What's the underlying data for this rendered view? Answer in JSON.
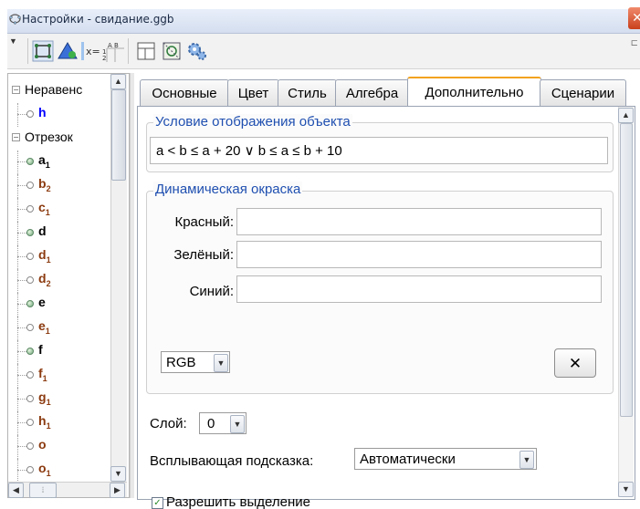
{
  "window": {
    "title": "Настройки - свидание.ggb",
    "close_symbol": "✕"
  },
  "toolbar": {
    "icons": [
      "basic-icon",
      "style-triangle-icon",
      "algebra-icon",
      "spreadsheet-icon",
      "layout-icon",
      "graphics-icon",
      "advanced-gear-icon"
    ]
  },
  "tree": {
    "items": [
      {
        "type": "group",
        "label": "Неравенс"
      },
      {
        "type": "item",
        "label": "h",
        "sub": "",
        "color": "#0000ff",
        "filled": false
      },
      {
        "type": "group",
        "label": "Отрезок"
      },
      {
        "type": "item",
        "label": "a",
        "sub": "1",
        "color": "#000000",
        "filled": true
      },
      {
        "type": "item",
        "label": "b",
        "sub": "2",
        "color": "#8b3a0f",
        "filled": false
      },
      {
        "type": "item",
        "label": "c",
        "sub": "1",
        "color": "#8b3a0f",
        "filled": false
      },
      {
        "type": "item",
        "label": "d",
        "sub": "",
        "color": "#000000",
        "filled": true
      },
      {
        "type": "item",
        "label": "d",
        "sub": "1",
        "color": "#8b3a0f",
        "filled": false
      },
      {
        "type": "item",
        "label": "d",
        "sub": "2",
        "color": "#8b3a0f",
        "filled": false
      },
      {
        "type": "item",
        "label": "e",
        "sub": "",
        "color": "#000000",
        "filled": true
      },
      {
        "type": "item",
        "label": "e",
        "sub": "1",
        "color": "#8b3a0f",
        "filled": false
      },
      {
        "type": "item",
        "label": "f",
        "sub": "",
        "color": "#000000",
        "filled": true
      },
      {
        "type": "item",
        "label": "f",
        "sub": "1",
        "color": "#8b3a0f",
        "filled": false
      },
      {
        "type": "item",
        "label": "g",
        "sub": "1",
        "color": "#8b3a0f",
        "filled": false
      },
      {
        "type": "item",
        "label": "h",
        "sub": "1",
        "color": "#8b3a0f",
        "filled": false
      },
      {
        "type": "item",
        "label": "o",
        "sub": "",
        "color": "#8b3a0f",
        "filled": false
      },
      {
        "type": "item",
        "label": "o",
        "sub": "1",
        "color": "#8b3a0f",
        "filled": false
      }
    ]
  },
  "tabs": [
    {
      "label": "Основные",
      "active": false
    },
    {
      "label": "Цвет",
      "active": false
    },
    {
      "label": "Стиль",
      "active": false
    },
    {
      "label": "Алгебра",
      "active": false
    },
    {
      "label": "Дополнительно",
      "active": true
    },
    {
      "label": "Сценарии",
      "active": false
    }
  ],
  "condition": {
    "legend": "Условие отображения объекта",
    "value": "a  <  b ≤ a + 20 ∨ b ≤ a ≤ b + 10"
  },
  "dynamic_color": {
    "legend": "Динамическая окраска",
    "red_label": "Красный:",
    "green_label": "Зелёный:",
    "blue_label": "Синий:",
    "red_value": "",
    "green_value": "",
    "blue_value": "",
    "mode": "RGB",
    "clear_symbol": "✕"
  },
  "layer": {
    "label": "Слой:",
    "value": "0"
  },
  "tooltip": {
    "label": "Всплывающая подсказка:",
    "value": "Автоматически"
  },
  "selection_checkbox": {
    "label": "Разрешить выделение",
    "checked": true
  }
}
